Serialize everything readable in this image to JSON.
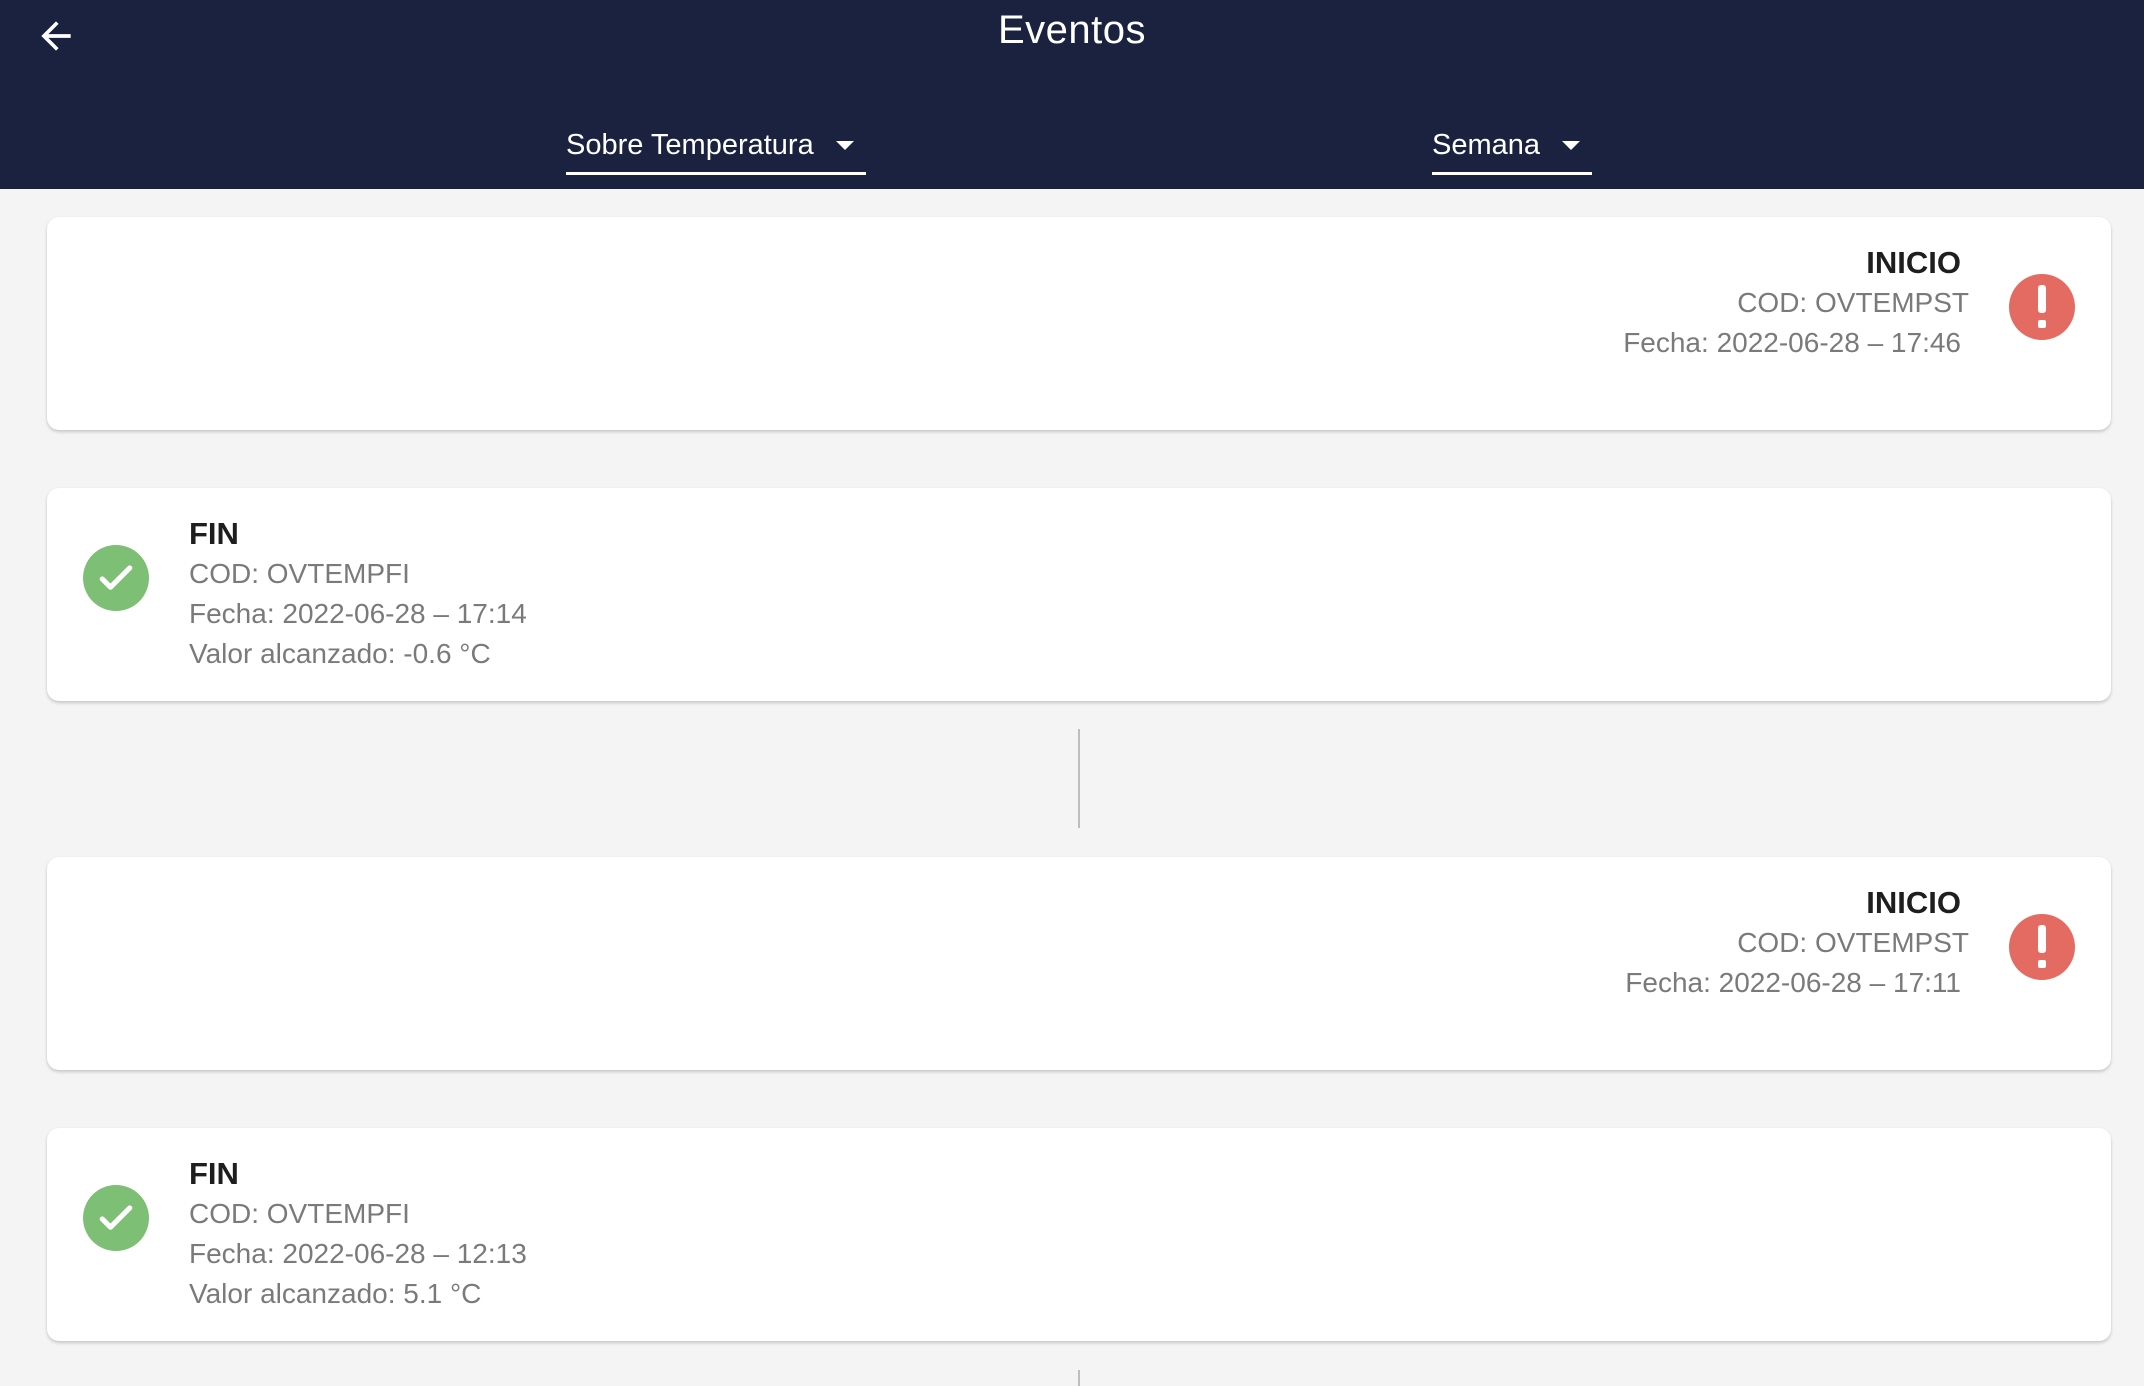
{
  "header": {
    "title": "Eventos",
    "event_type_dropdown": {
      "value": "Sobre Temperatura"
    },
    "period_dropdown": {
      "value": "Semana"
    }
  },
  "colors": {
    "app_bar": "#1a2240",
    "alert": "#e46b62",
    "success": "#7dbf74",
    "background": "#f4f4f4"
  },
  "icons": {
    "back": "arrow-left-icon",
    "alert": "exclamation-circle-icon",
    "success": "check-circle-icon",
    "dropdown": "caret-down-icon"
  },
  "events": [
    {
      "title": "INICIO",
      "code": "COD: OVTEMPST",
      "date": "Fecha: 2022-06-28 – 17:46"
    },
    {
      "title": "FIN",
      "code": "COD: OVTEMPFI",
      "date": "Fecha: 2022-06-28 – 17:14",
      "value": "Valor alcanzado: -0.6 °C"
    },
    {
      "title": "INICIO",
      "code": "COD: OVTEMPST",
      "date": "Fecha: 2022-06-28 – 17:11"
    },
    {
      "title": "FIN",
      "code": "COD: OVTEMPFI",
      "date": "Fecha: 2022-06-28 – 12:13",
      "value": "Valor alcanzado: 5.1 °C"
    }
  ]
}
